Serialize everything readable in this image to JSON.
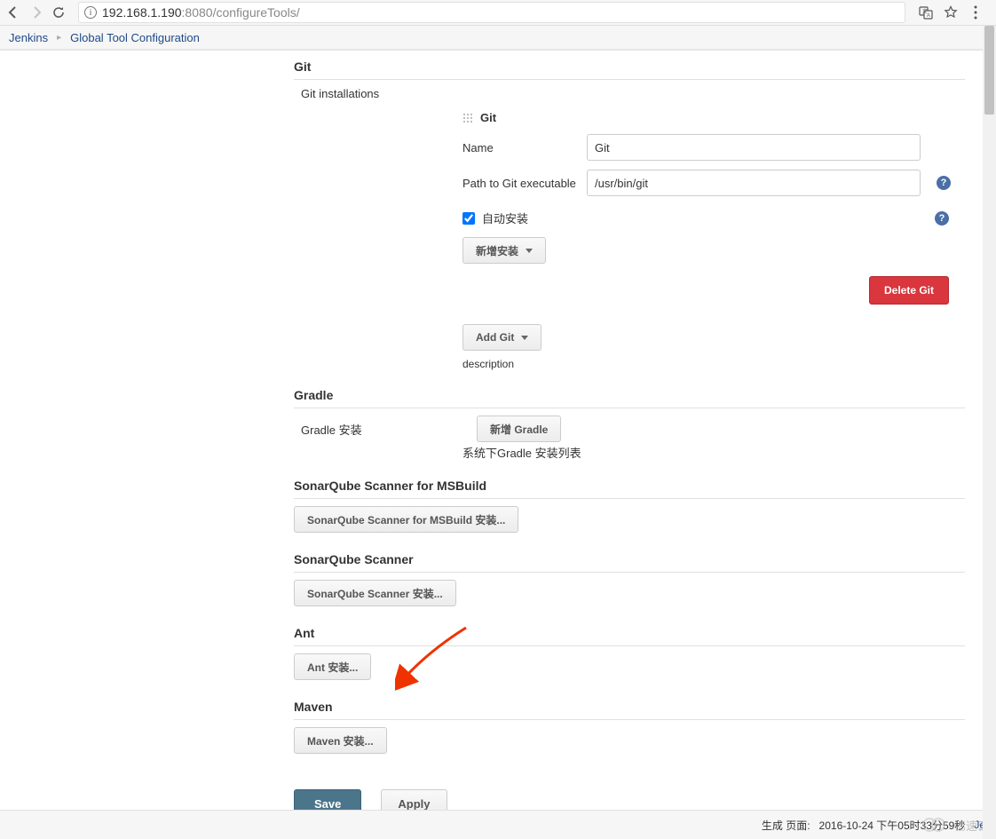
{
  "browser": {
    "url_host": "192.168.1.190",
    "url_port_path": ":8080/configureTools/"
  },
  "breadcrumb": {
    "root": "Jenkins",
    "page": "Global Tool Configuration"
  },
  "git": {
    "section": "Git",
    "installations_label": "Git installations",
    "block_title": "Git",
    "name_label": "Name",
    "name_value": "Git",
    "path_label": "Path to Git executable",
    "path_value": "/usr/bin/git",
    "auto_install_label": "自动安装",
    "add_install_btn": "新增安装",
    "delete_btn": "Delete Git",
    "add_git_btn": "Add Git",
    "description": "description"
  },
  "gradle": {
    "section": "Gradle",
    "install_label": "Gradle 安装",
    "add_btn": "新增 Gradle",
    "list_label": "系统下Gradle 安装列表"
  },
  "sonar_msbuild": {
    "section": "SonarQube Scanner for MSBuild",
    "btn": "SonarQube Scanner for MSBuild 安装..."
  },
  "sonar": {
    "section": "SonarQube Scanner",
    "btn": "SonarQube Scanner 安装..."
  },
  "ant": {
    "section": "Ant",
    "btn": "Ant 安装..."
  },
  "maven": {
    "section": "Maven",
    "btn": "Maven 安装..."
  },
  "footer": {
    "save": "Save",
    "apply": "Apply"
  },
  "status": {
    "gen_label": "生成 页面:",
    "gen_value": "2016-10-24 下午05时33分59秒",
    "link": "Je"
  },
  "watermark": "亿速云"
}
